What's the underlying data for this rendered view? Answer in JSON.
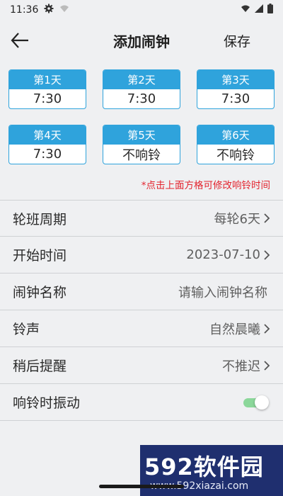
{
  "status": {
    "time": "11:36"
  },
  "header": {
    "title": "添加闹钟",
    "save_label": "保存"
  },
  "days": [
    {
      "label": "第1天",
      "time": "7:30"
    },
    {
      "label": "第2天",
      "time": "7:30"
    },
    {
      "label": "第3天",
      "time": "7:30"
    },
    {
      "label": "第4天",
      "time": "7:30"
    },
    {
      "label": "第5天",
      "time": "不响铃"
    },
    {
      "label": "第6天",
      "time": "不响铃"
    }
  ],
  "hint": "*点击上面方格可修改响铃时间",
  "settings": {
    "cycle": {
      "label": "轮班周期",
      "value": "每轮6天"
    },
    "start": {
      "label": "开始时间",
      "value": "2023-07-10"
    },
    "name": {
      "label": "闹钟名称",
      "placeholder": "请输入闹钟名称"
    },
    "ringtone": {
      "label": "铃声",
      "value": "自然晨曦"
    },
    "snooze": {
      "label": "稍后提醒",
      "value": "不推迟"
    },
    "vibrate": {
      "label": "响铃时振动",
      "on": true
    }
  },
  "watermark": {
    "logo_num": "592",
    "logo_text": "软件园",
    "url": "www.592xiazai.com"
  },
  "colors": {
    "accent": "#2fa3dc",
    "hint": "#e3252f",
    "toggle": "#8bd79a"
  }
}
